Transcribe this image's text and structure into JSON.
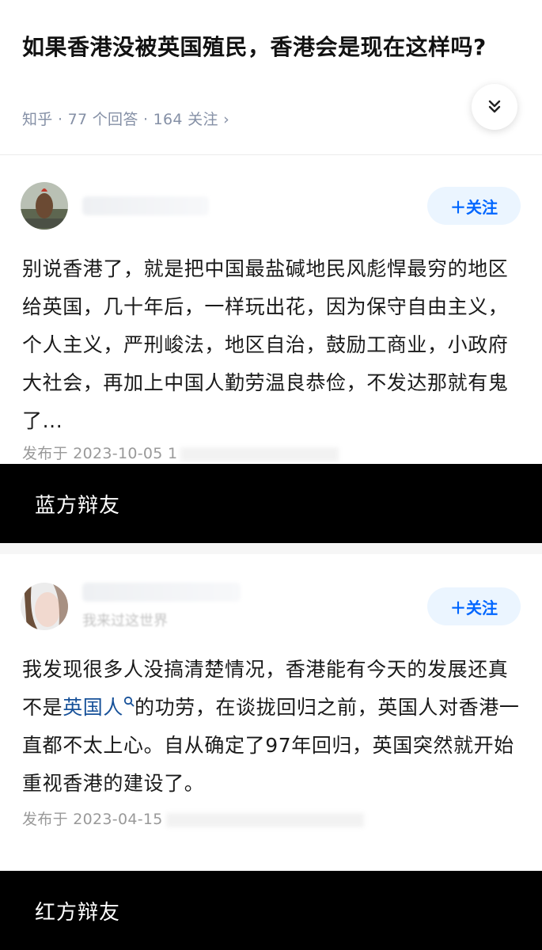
{
  "question": {
    "title": "如果香港没被英国殖民，香港会是现在这样吗?",
    "meta": "知乎 · 77 个回答 · 164 关注 ›"
  },
  "answers": [
    {
      "follow_label": "＋关注",
      "text": "别说香港了，就是把中国最盐碱地民风彪悍最穷的地区给英国，几十年后，一样玩出花，因为保守自由主义，个人主义，严刑峻法，地区自治，鼓励工商业，小政府大社会，再加上中国人勤劳温良恭俭，不发达那就有鬼了...",
      "published": "发布于 2023-10-05 1"
    },
    {
      "follow_label": "＋关注",
      "author_tagline": "我来过这世界",
      "text_before": "我发现很多人没搞清楚情况，香港能有今天的发展还真不是",
      "link": "英国人",
      "text_after": "的功劳，在谈拢回归之前，英国人对香港一直都不太上心。自从确定了97年回归，英国突然就开始重视香港的建设了。",
      "published": "发布于 2023-04-15"
    }
  ],
  "captions": {
    "blue": "蓝方辩友",
    "red": "红方辩友"
  },
  "colors": {
    "accent": "#0066ff",
    "link": "#175199",
    "meta": "#8590a6"
  }
}
